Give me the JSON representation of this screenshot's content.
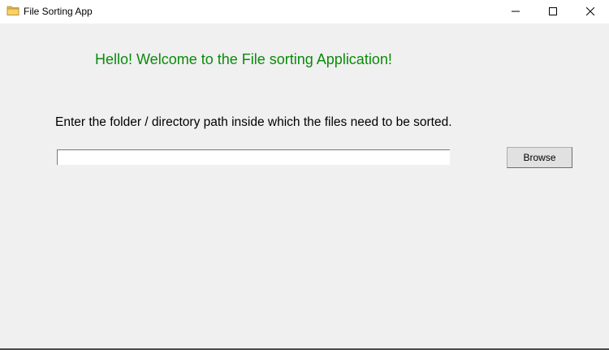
{
  "window": {
    "title": "File Sorting App",
    "icon": "folder-icon",
    "controls": [
      "minimize-icon",
      "maximize-icon",
      "close-icon"
    ]
  },
  "main": {
    "welcome_text": "Hello! Welcome to the File sorting Application!",
    "instruction_text": "Enter the folder / directory path inside which the files need to be sorted.",
    "path_input_value": "",
    "browse_label": "Browse"
  },
  "colors": {
    "welcome_text": "#0a8a0a",
    "background": "#f0f0f0"
  }
}
